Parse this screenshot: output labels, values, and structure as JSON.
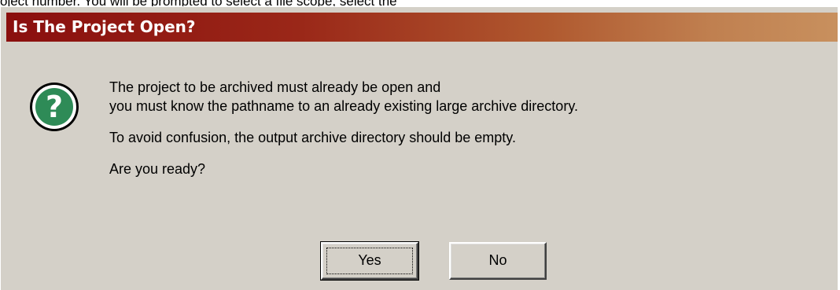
{
  "background_text": "oject number. You will be prompted to select a file scope, select the",
  "dialog": {
    "title": "Is The Project Open?",
    "icon": "question-icon",
    "message": {
      "line1": "The project to be archived must already be open and",
      "line2": "you must know the pathname to an already existing large archive directory.",
      "line3": "To avoid confusion, the output archive directory should be empty.",
      "line4": "Are you ready?"
    },
    "buttons": {
      "yes_label": "Yes",
      "no_label": "No"
    },
    "colors": {
      "titlebar_start": "#8a0f0e",
      "titlebar_end": "#c8905e",
      "face": "#d4d0c8",
      "icon": "#2e8b57"
    }
  }
}
